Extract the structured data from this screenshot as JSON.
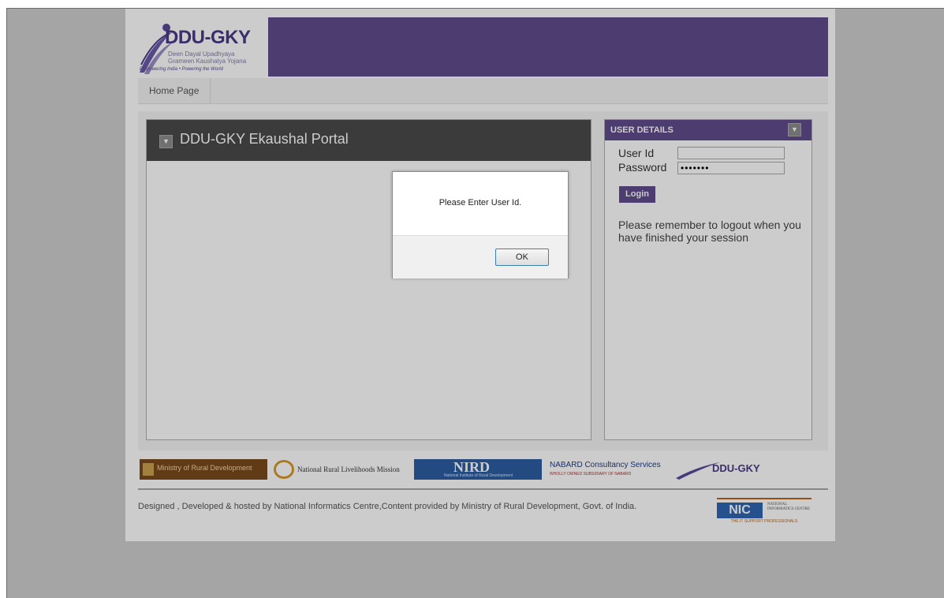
{
  "header": {
    "logo_title": "DDU-GKY",
    "logo_subtitle_line1": "Deen Dayal Upadhyaya",
    "logo_subtitle_line2": "Grameen Kaushalya Yojana",
    "logo_tagline": "Empowering India • Powering the World"
  },
  "nav": {
    "home_label": "Home Page"
  },
  "portal": {
    "title": "DDU-GKY Ekaushal Portal"
  },
  "user_details": {
    "title": "USER DETAILS",
    "userid_label": "User Id",
    "userid_value": "",
    "password_label": "Password",
    "password_value": "•••••••",
    "login_label": "Login",
    "logout_note": "Please remember to logout when you have finished your session"
  },
  "partners": {
    "mord": "Ministry of Rural Development",
    "nrlm": "National Rural Livelihoods Mission",
    "nird": "NIRD",
    "nird_sub": "National Institute of Rural Development",
    "nabard": "NABARD Consultancy Services",
    "nabard_sub": "WHOLLY OWNED SUBSIDIARY OF NABARD",
    "ddugky": "DDU-GKY"
  },
  "footer": {
    "text": "Designed , Developed & hosted by National Informatics Centre,Content provided by Ministry of Rural Development, Govt. of India.",
    "nic": "NIC",
    "nic_full": "NATIONAL INFORMATICS CENTRE",
    "nic_tagline": "THE IT SUPPORT PROFESSIONALS"
  },
  "dialog": {
    "message": "Please Enter User Id.",
    "ok_label": "OK"
  },
  "colors": {
    "brand_purple": "#5f4b8b",
    "panel_dark": "#4a4a4a",
    "ok_border": "#3c7fb1"
  }
}
